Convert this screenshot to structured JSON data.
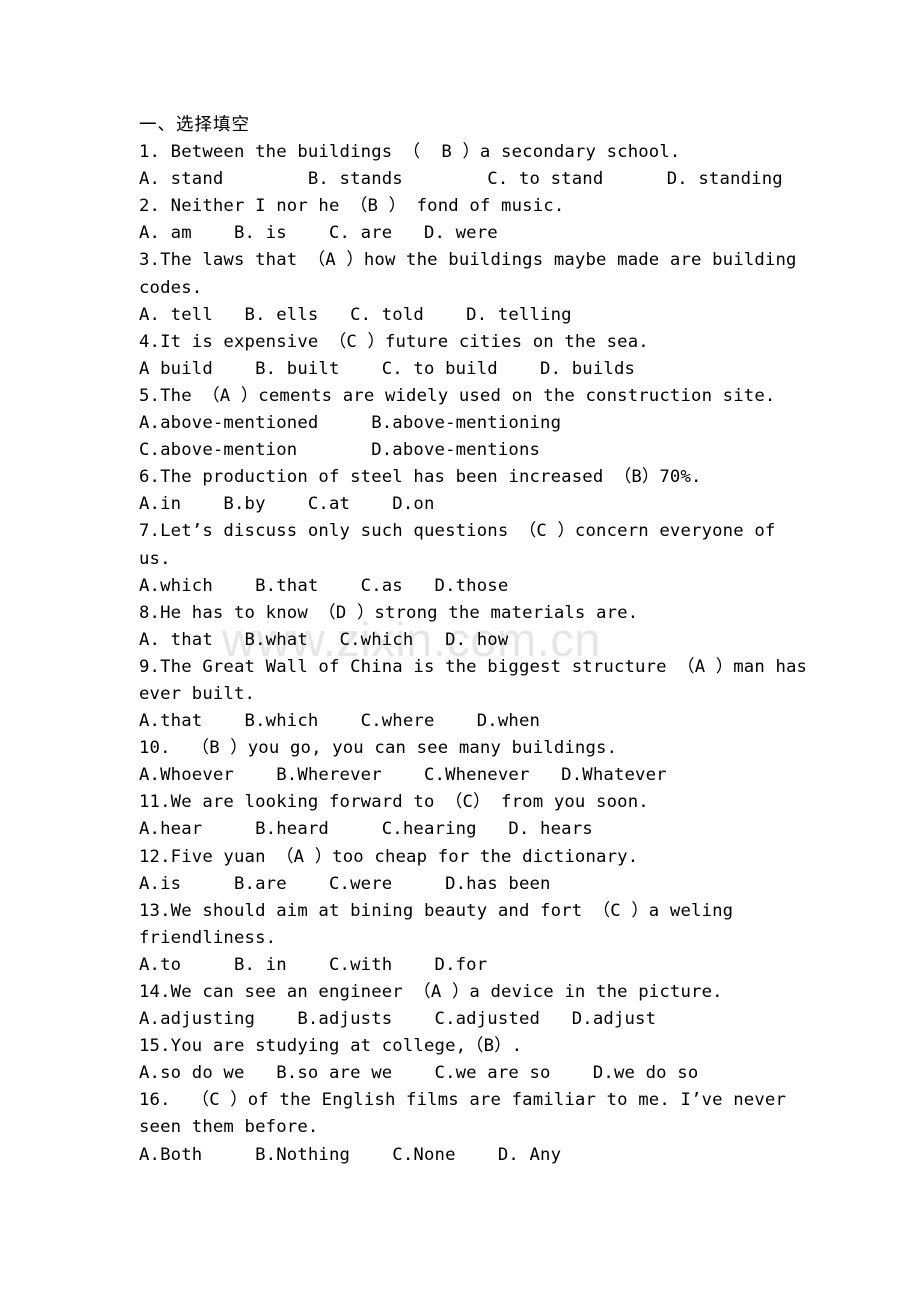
{
  "page": {
    "watermark": "www.zixin.com.cn",
    "watermark_color": "#e6e6e6",
    "text_color": "#000000",
    "background_color": "#ffffff"
  },
  "document": {
    "heading": "一、选择填空",
    "lines": [
      {
        "kind": "q",
        "text": "1. Between the buildings （  B ）a secondary school."
      },
      {
        "kind": "opt",
        "text": "A. stand        B. stands        C. to stand      D. standing"
      },
      {
        "kind": "q",
        "text": "2. Neither I nor he （B ） fond of music."
      },
      {
        "kind": "opt",
        "text": "A. am    B. is    C. are   D. were"
      },
      {
        "kind": "q",
        "text": "3.The laws that （A ）how the buildings maybe made are building"
      },
      {
        "kind": "cont",
        "text": "codes."
      },
      {
        "kind": "opt",
        "text": "A. tell   B. ells   C. told    D. telling"
      },
      {
        "kind": "q",
        "text": "4.It is expensive （C ）future cities on the sea."
      },
      {
        "kind": "opt",
        "text": "A build    B. built    C. to build    D. builds"
      },
      {
        "kind": "q",
        "text": "5.The （A ）cements are widely used on the construction site."
      },
      {
        "kind": "opt",
        "text": "A.above-mentioned     B.above-mentioning"
      },
      {
        "kind": "opt",
        "text": "C.above-mention       D.above-mentions"
      },
      {
        "kind": "q",
        "text": "6.The production of steel has been increased （B）70%."
      },
      {
        "kind": "opt",
        "text": "A.in    B.by    C.at    D.on"
      },
      {
        "kind": "q",
        "text": "7.Let’s discuss only such questions （C ）concern everyone of"
      },
      {
        "kind": "cont",
        "text": "us."
      },
      {
        "kind": "opt",
        "text": "A.which    B.that    C.as   D.those"
      },
      {
        "kind": "q",
        "text": "8.He has to know （D ）strong the materials are."
      },
      {
        "kind": "opt",
        "text": "A. that   B.what   C.which   D. how"
      },
      {
        "kind": "q",
        "text": "9.The Great Wall of China is the biggest structure （A ）man has"
      },
      {
        "kind": "cont",
        "text": "ever built."
      },
      {
        "kind": "opt",
        "text": "A.that    B.which    C.where    D.when"
      },
      {
        "kind": "q",
        "text": "10.  （B ）you go, you can see many buildings."
      },
      {
        "kind": "opt",
        "text": "A.Whoever    B.Wherever    C.Whenever   D.Whatever"
      },
      {
        "kind": "q",
        "text": "11.We are looking forward to （C） from you soon."
      },
      {
        "kind": "opt",
        "text": "A.hear     B.heard     C.hearing   D. hears"
      },
      {
        "kind": "q",
        "text": "12.Five yuan （A ）too cheap for the dictionary."
      },
      {
        "kind": "opt",
        "text": "A.is     B.are    C.were     D.has been"
      },
      {
        "kind": "q",
        "text": "13.We should aim at bining beauty and fort （C ）a weling"
      },
      {
        "kind": "cont",
        "text": "friendliness."
      },
      {
        "kind": "opt",
        "text": "A.to     B. in    C.with    D.for"
      },
      {
        "kind": "q",
        "text": "14.We can see an engineer （A ）a device in the picture."
      },
      {
        "kind": "opt",
        "text": "A.adjusting    B.adjusts    C.adjusted   D.adjust"
      },
      {
        "kind": "q",
        "text": "15.You are studying at college,（B）."
      },
      {
        "kind": "opt",
        "text": "A.so do we   B.so are we    C.we are so    D.we do so"
      },
      {
        "kind": "q",
        "text": "16.  （C ）of the English films are familiar to me. I’ve never"
      },
      {
        "kind": "cont",
        "text": "seen them before."
      },
      {
        "kind": "opt",
        "text": "A.Both     B.Nothing    C.None    D. Any"
      }
    ]
  }
}
